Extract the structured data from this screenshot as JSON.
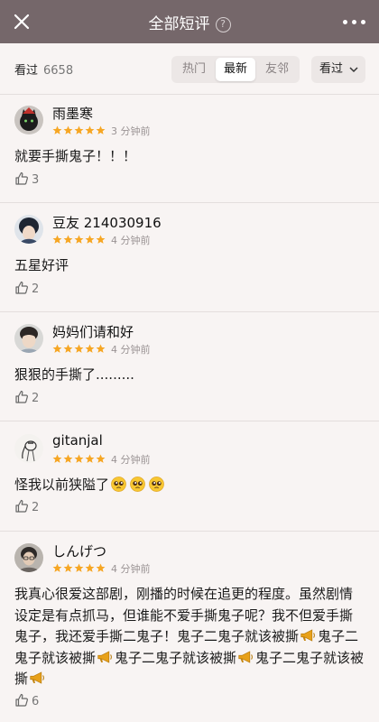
{
  "header": {
    "title": "全部短评",
    "help_glyph": "?"
  },
  "filter": {
    "seen_label": "看过",
    "seen_count": "6658",
    "tabs": [
      {
        "label": "热门",
        "selected": false
      },
      {
        "label": "最新",
        "selected": true
      },
      {
        "label": "友邻",
        "selected": false
      }
    ],
    "sort_label": "看过"
  },
  "colors": {
    "header_bg": "#75676a",
    "star": "#f6a623",
    "page_bg": "#f8f4f3"
  },
  "reviews": [
    {
      "username": "雨墨寒",
      "rating": 5,
      "time": "3 分钟前",
      "text": "就要手撕鬼子！！！",
      "likes": "3",
      "avatar": "avatar-black-cat"
    },
    {
      "username": "豆友 214030916",
      "rating": 5,
      "time": "4 分钟前",
      "text": "五星好评",
      "likes": "2",
      "avatar": "avatar-dark-hair"
    },
    {
      "username": "妈妈们请和好",
      "rating": 5,
      "time": "4 分钟前",
      "text": "狠狠的手撕了.........",
      "likes": "2",
      "avatar": "avatar-boy"
    },
    {
      "username": "gitanjal",
      "rating": 5,
      "time": "4 分钟前",
      "text": "怪我以前狭隘了",
      "emoji_suffix": "pleading-face x3",
      "likes": "2",
      "avatar": "avatar-sketch"
    },
    {
      "username": "しんげつ",
      "rating": 5,
      "time": "4 分钟前",
      "text_parts": [
        "我真心很爱这部剧，刚播的时候在追更的程度。虽然剧情设定是有点抓马，但谁能不爱手撕鬼子呢？我不但爱手撕鬼子，我还爱手撕二鬼子！鬼子二鬼子就该被撕",
        "鬼子二鬼子就该被撕",
        "鬼子二鬼子就该被撕",
        "鬼子二鬼子就该被撕"
      ],
      "inline_icon": "megaphone-icon",
      "likes": "6",
      "avatar": "avatar-photo"
    }
  ]
}
